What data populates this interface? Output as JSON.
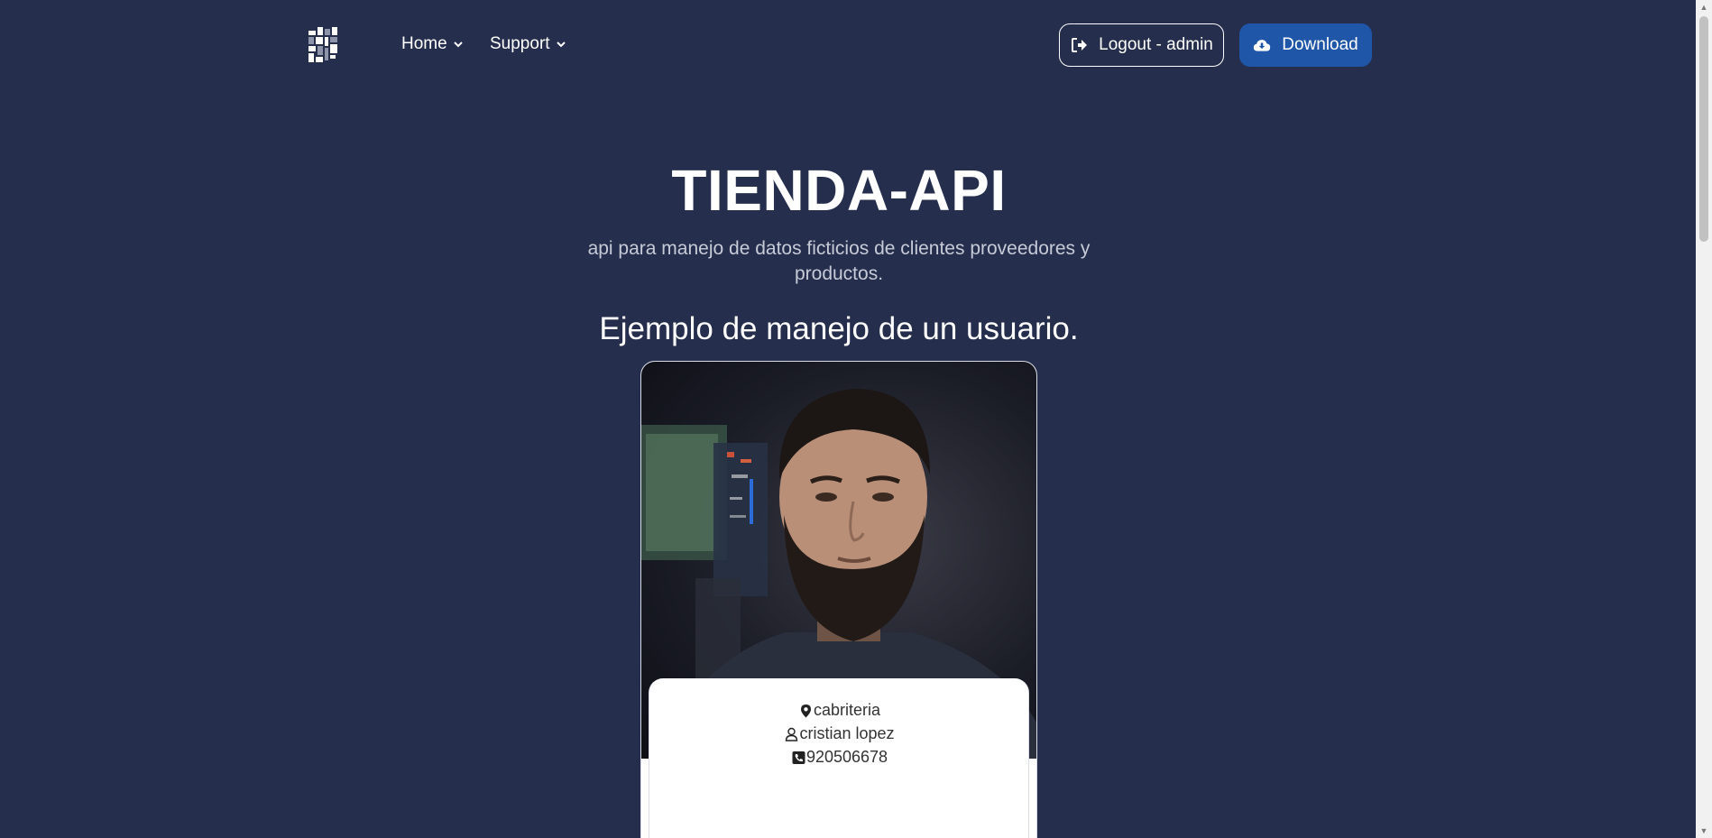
{
  "nav": {
    "logo_icon": "grid-logo-icon",
    "items": [
      {
        "label": "Home"
      },
      {
        "label": "Support"
      }
    ],
    "logout_label": "Logout - admin",
    "download_label": "Download"
  },
  "hero": {
    "title": "TIENDA-API",
    "subtitle": "api para manejo de datos ficticios de clientes proveedores y productos.",
    "heading": "Ejemplo de manejo de un usuario."
  },
  "user_card": {
    "location": "cabriteria",
    "name": "cristian lopez",
    "phone": "920506678",
    "icons": {
      "location": "map-pin-icon",
      "name": "user-icon",
      "phone": "phone-icon"
    }
  },
  "colors": {
    "background": "#252e4c",
    "download_button": "#1f56a8",
    "text_muted": "#c7cbd8"
  }
}
